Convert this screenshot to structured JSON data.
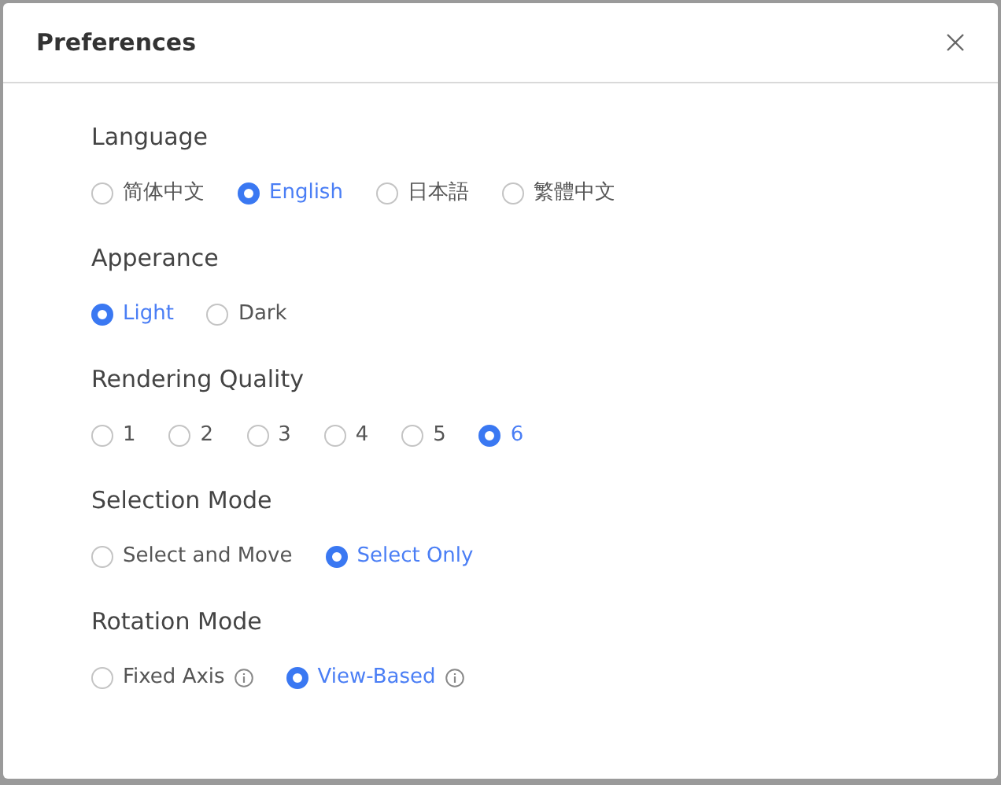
{
  "dialog": {
    "title": "Preferences"
  },
  "sections": [
    {
      "label": "Language",
      "options": [
        {
          "label": "简体中文",
          "selected": false
        },
        {
          "label": "English",
          "selected": true
        },
        {
          "label": "日本語",
          "selected": false
        },
        {
          "label": "繁體中文",
          "selected": false
        }
      ]
    },
    {
      "label": "Apperance",
      "options": [
        {
          "label": "Light",
          "selected": true
        },
        {
          "label": "Dark",
          "selected": false
        }
      ]
    },
    {
      "label": "Rendering Quality",
      "options": [
        {
          "label": "1",
          "selected": false
        },
        {
          "label": "2",
          "selected": false
        },
        {
          "label": "3",
          "selected": false
        },
        {
          "label": "4",
          "selected": false
        },
        {
          "label": "5",
          "selected": false
        },
        {
          "label": "6",
          "selected": true
        }
      ]
    },
    {
      "label": "Selection Mode",
      "options": [
        {
          "label": "Select and Move",
          "selected": false
        },
        {
          "label": "Select Only",
          "selected": true
        }
      ]
    },
    {
      "label": "Rotation Mode",
      "options": [
        {
          "label": "Fixed Axis",
          "selected": false,
          "info": true
        },
        {
          "label": "View-Based",
          "selected": true,
          "info": true
        }
      ]
    }
  ]
}
